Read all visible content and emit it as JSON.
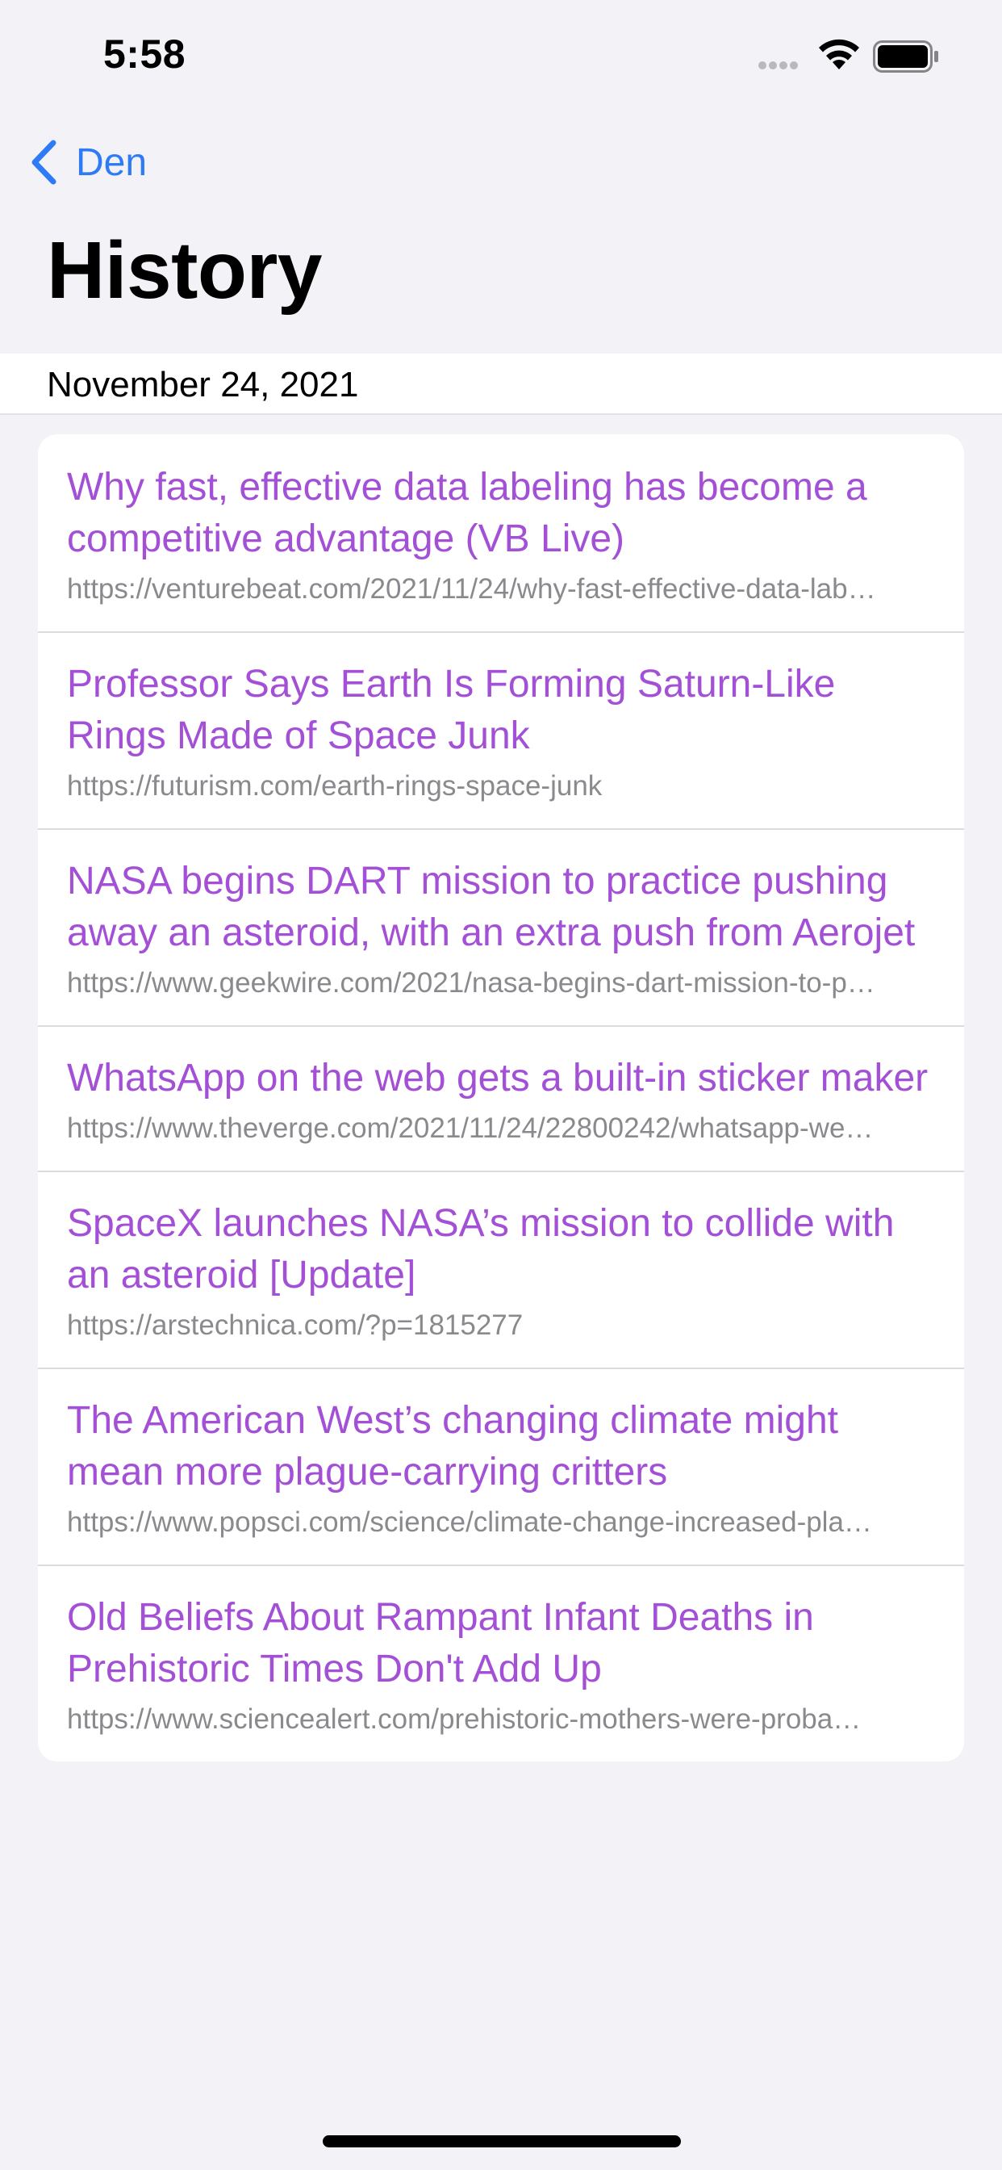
{
  "status_bar": {
    "time": "5:58",
    "icons": [
      "cellular-dots-icon",
      "wifi-icon",
      "battery-icon"
    ]
  },
  "nav": {
    "back_label": "Den",
    "back_icon": "chevron-left-icon",
    "title": "History"
  },
  "section": {
    "date": "November 24, 2021"
  },
  "history": [
    {
      "title": "Why fast, effective data labeling has become a competitive advantage (VB Live)",
      "url": "https://venturebeat.com/2021/11/24/why-fast-effective-data-lab…"
    },
    {
      "title": "Professor Says Earth Is Forming Saturn-Like Rings Made of Space Junk",
      "url": "https://futurism.com/earth-rings-space-junk"
    },
    {
      "title": "NASA begins DART mission to practice pushing away an asteroid, with an extra push from Aerojet",
      "url": "https://www.geekwire.com/2021/nasa-begins-dart-mission-to-p…"
    },
    {
      "title": "WhatsApp on the web gets a built-in sticker maker",
      "url": "https://www.theverge.com/2021/11/24/22800242/whatsapp-we…"
    },
    {
      "title": "SpaceX launches NASA’s mission to collide with an asteroid [Update]",
      "url": "https://arstechnica.com/?p=1815277"
    },
    {
      "title": "The American West’s changing climate might mean more plague-carrying critters",
      "url": "https://www.popsci.com/science/climate-change-increased-pla…"
    },
    {
      "title": "Old Beliefs About Rampant Infant Deaths in Prehistoric Times Don't Add Up",
      "url": "https://www.sciencealert.com/prehistoric-mothers-were-proba…"
    }
  ],
  "colors": {
    "link_title": "#A350D6",
    "accent": "#2F7BF6",
    "url_text": "#8A8A8E",
    "background": "#F2F2F7"
  }
}
